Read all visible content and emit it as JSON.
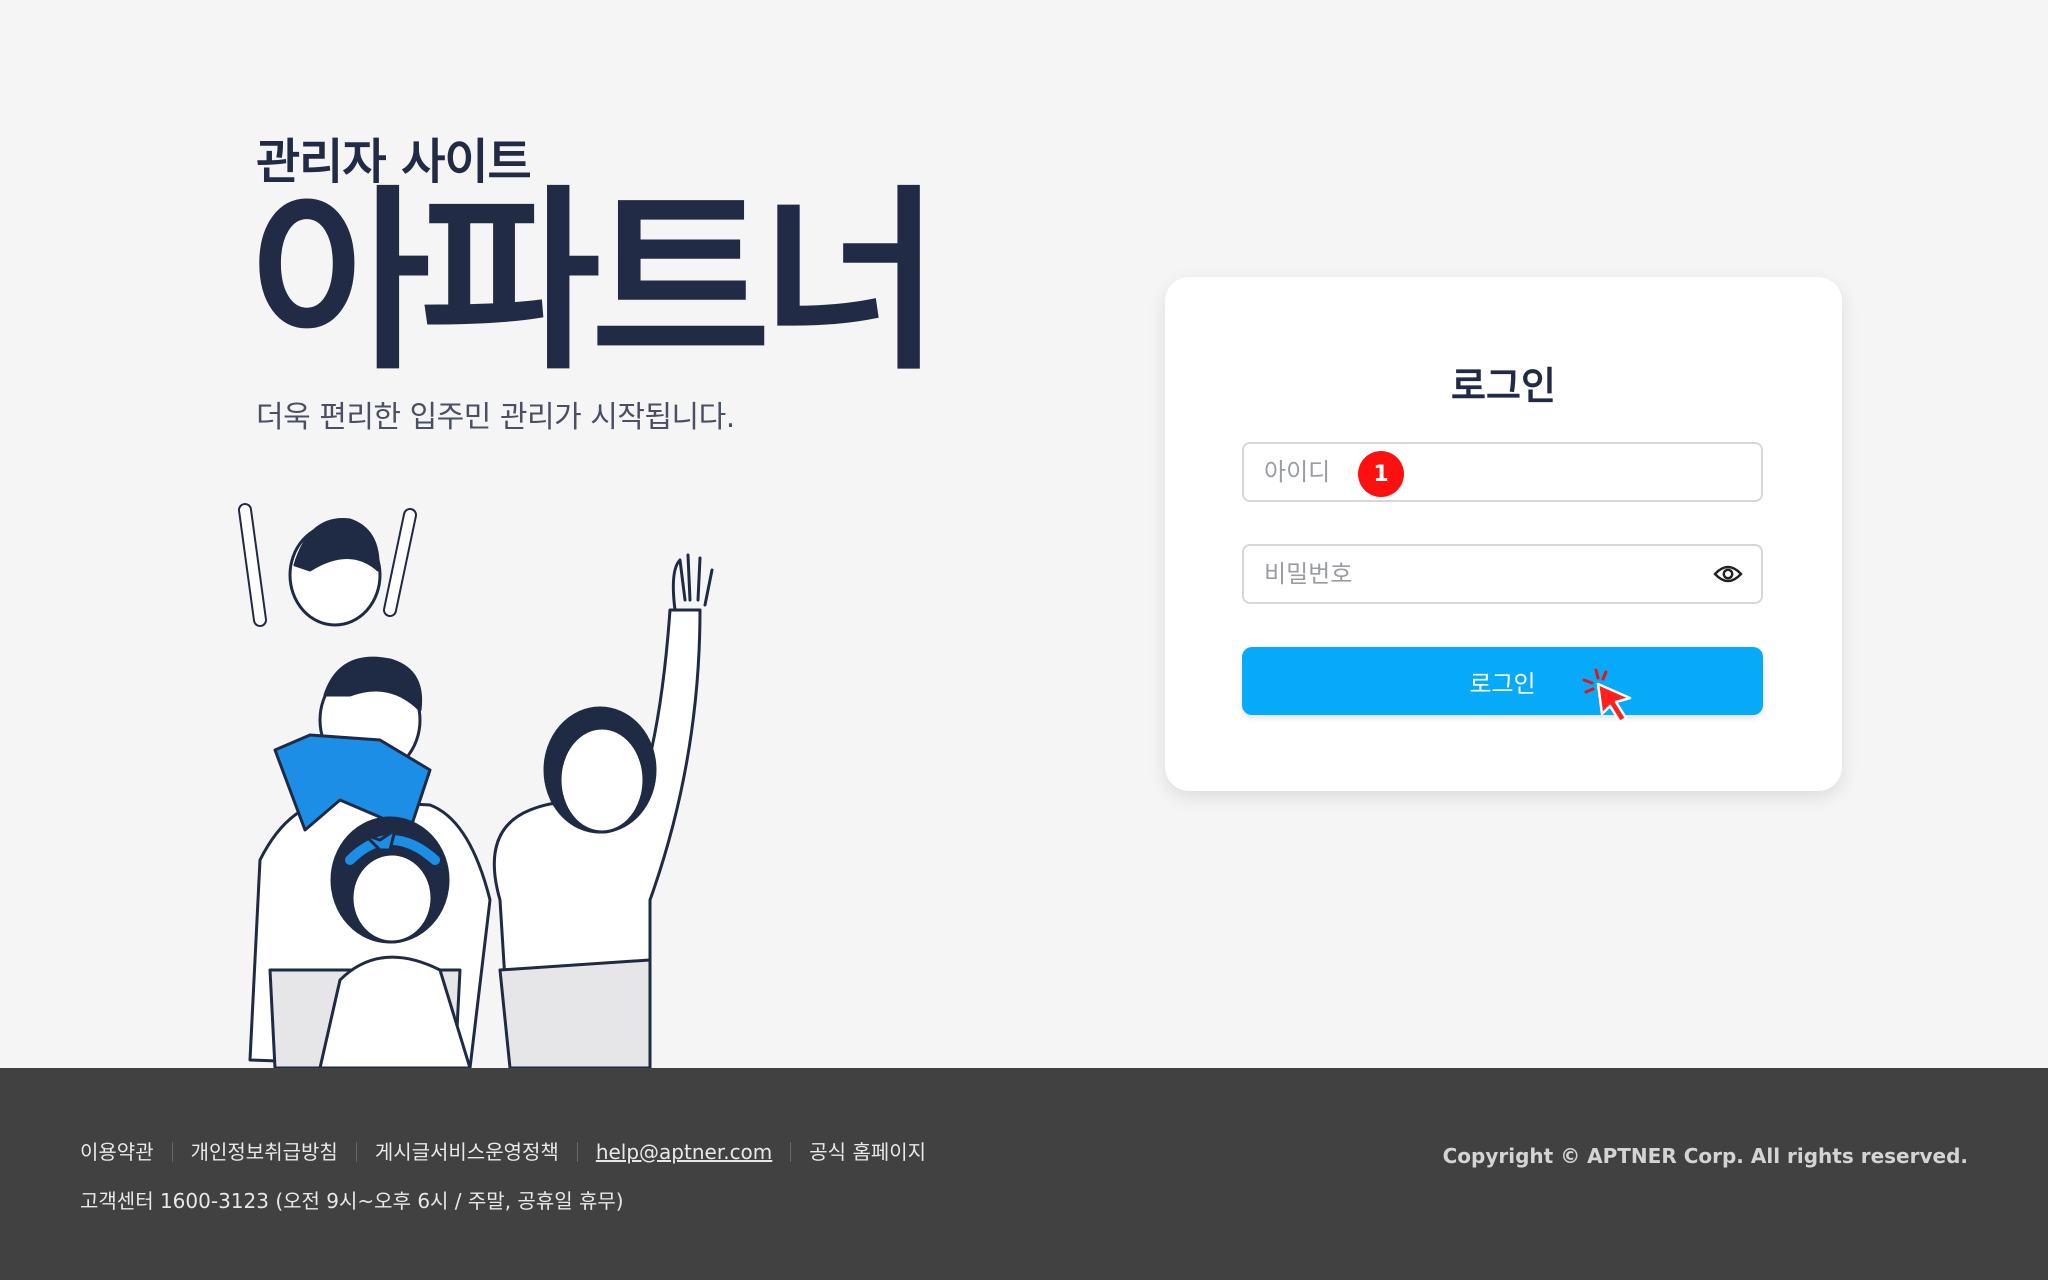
{
  "hero": {
    "subtitle": "관리자 사이트",
    "title": "아파트너",
    "tagline": "더욱 편리한 입주민 관리가 시작됩니다."
  },
  "login": {
    "title": "로그인",
    "id_placeholder": "아이디",
    "password_placeholder": "비밀번호",
    "button_label": "로그인",
    "step_badge": "1",
    "button_color": "#06aaf8",
    "badge_color": "#ff1010",
    "icons": [
      "eye-icon",
      "click-cursor-icon"
    ]
  },
  "footer": {
    "links": [
      "이용약관",
      "개인정보취급방침",
      "게시글서비스운영정책",
      "help@aptner.com",
      "공식 홈페이지"
    ],
    "customer_center": "고객센터 1600-3123 (오전 9시~오후 6시 / 주말, 공휴일 휴무)",
    "copyright": "Copyright © APTNER Corp. All rights reserved.",
    "background": "#414141"
  }
}
